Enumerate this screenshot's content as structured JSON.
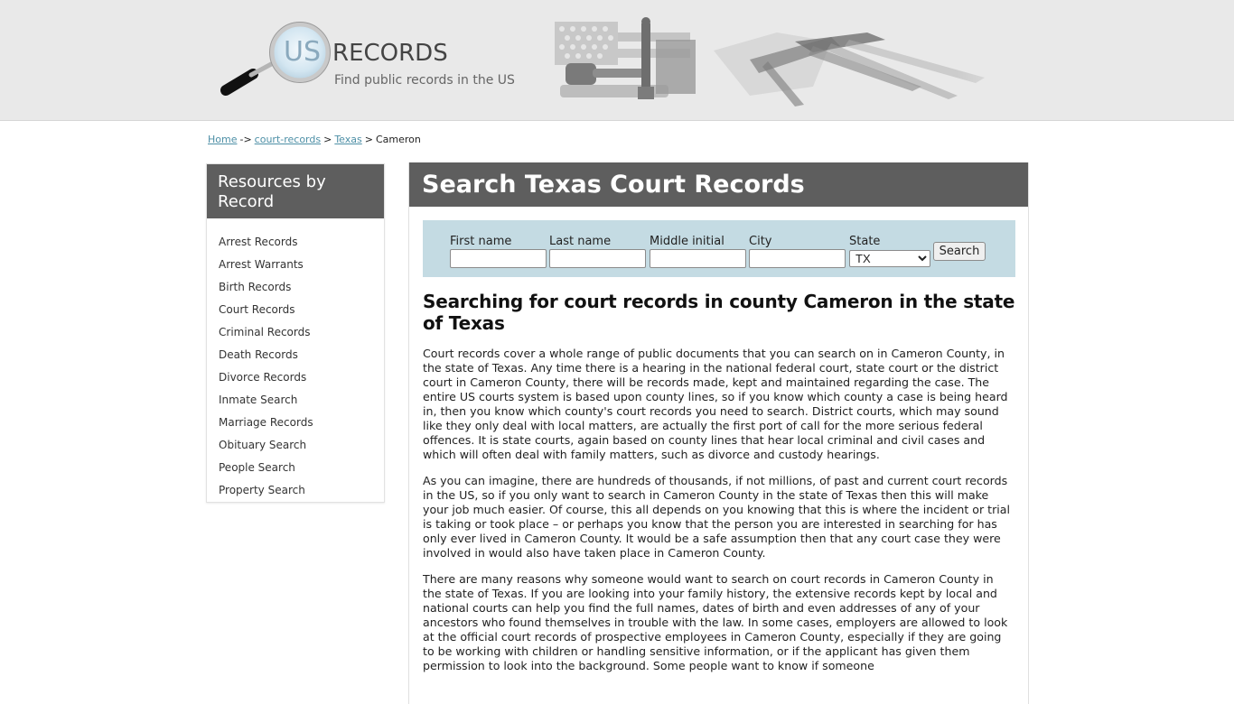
{
  "header": {
    "logo_us": "US",
    "logo_records": "RECORDS",
    "tagline": "Find public records in the US",
    "banner_alt": "court-gavel-scales-documents-banner"
  },
  "breadcrumb": {
    "items": [
      {
        "label": "Home",
        "link": true
      },
      {
        "label": "court-records",
        "link": true
      },
      {
        "label": "Texas",
        "link": true
      },
      {
        "label": "Cameron",
        "link": false
      }
    ],
    "separators": [
      "->",
      ">",
      ">"
    ]
  },
  "sidebar": {
    "title": "Resources by Record",
    "items": [
      {
        "label": "Arrest Records"
      },
      {
        "label": "Arrest Warrants"
      },
      {
        "label": "Birth Records"
      },
      {
        "label": "Court Records"
      },
      {
        "label": "Criminal Records"
      },
      {
        "label": "Death Records"
      },
      {
        "label": "Divorce Records"
      },
      {
        "label": "Inmate Search"
      },
      {
        "label": "Marriage Records"
      },
      {
        "label": "Obituary Search"
      },
      {
        "label": "People Search"
      },
      {
        "label": "Property Search"
      }
    ]
  },
  "main": {
    "title": "Search Texas Court Records",
    "search": {
      "first_name_label": "First name",
      "first_name_value": "",
      "last_name_label": "Last name",
      "last_name_value": "",
      "middle_initial_label": "Middle initial",
      "middle_initial_value": "",
      "city_label": "City",
      "city_value": "",
      "state_label": "State",
      "state_value": "TX",
      "button_label": "Search"
    },
    "heading": "Searching for court records in county Cameron in the state of Texas",
    "paragraphs": [
      "Court records cover a whole range of public documents that you can search on in Cameron County, in the state of Texas. Any time there is a hearing in the national federal court, state court or the district court in Cameron County, there will be records made, kept and maintained regarding the case. The entire US courts system is based upon county lines, so if you know which county a case is being heard in, then you know which county's court records you need to search. District courts, which may sound like they only deal with local matters, are actually the first port of call for the more serious federal offences. It is state courts, again based on county lines that hear local criminal and civil cases and which will often deal with family matters, such as divorce and custody hearings.",
      "As you can imagine, there are hundreds of thousands, if not millions, of past and current court records in the US, so if you only want to search in Cameron County in the state of Texas then this will make your job much easier. Of course, this all depends on you knowing that this is where the incident or trial is taking or took place – or perhaps you know that the person you are interested in searching for has only ever lived in Cameron County. It would be a safe assumption then that any court case they were involved in would also have taken place in Cameron County.",
      "There are many reasons why someone would want to search on court records in Cameron County in the state of Texas. If you are looking into your family history, the extensive records kept by local and national courts can help you find the full names, dates of birth and even addresses of any of your ancestors who found themselves in trouble with the law. In some cases, employers are allowed to look at the official court records of prospective employees in Cameron County, especially if they are going to be working with children or handling sensitive information, or if the applicant has given them permission to look into the background. Some people want to know if someone"
    ]
  }
}
